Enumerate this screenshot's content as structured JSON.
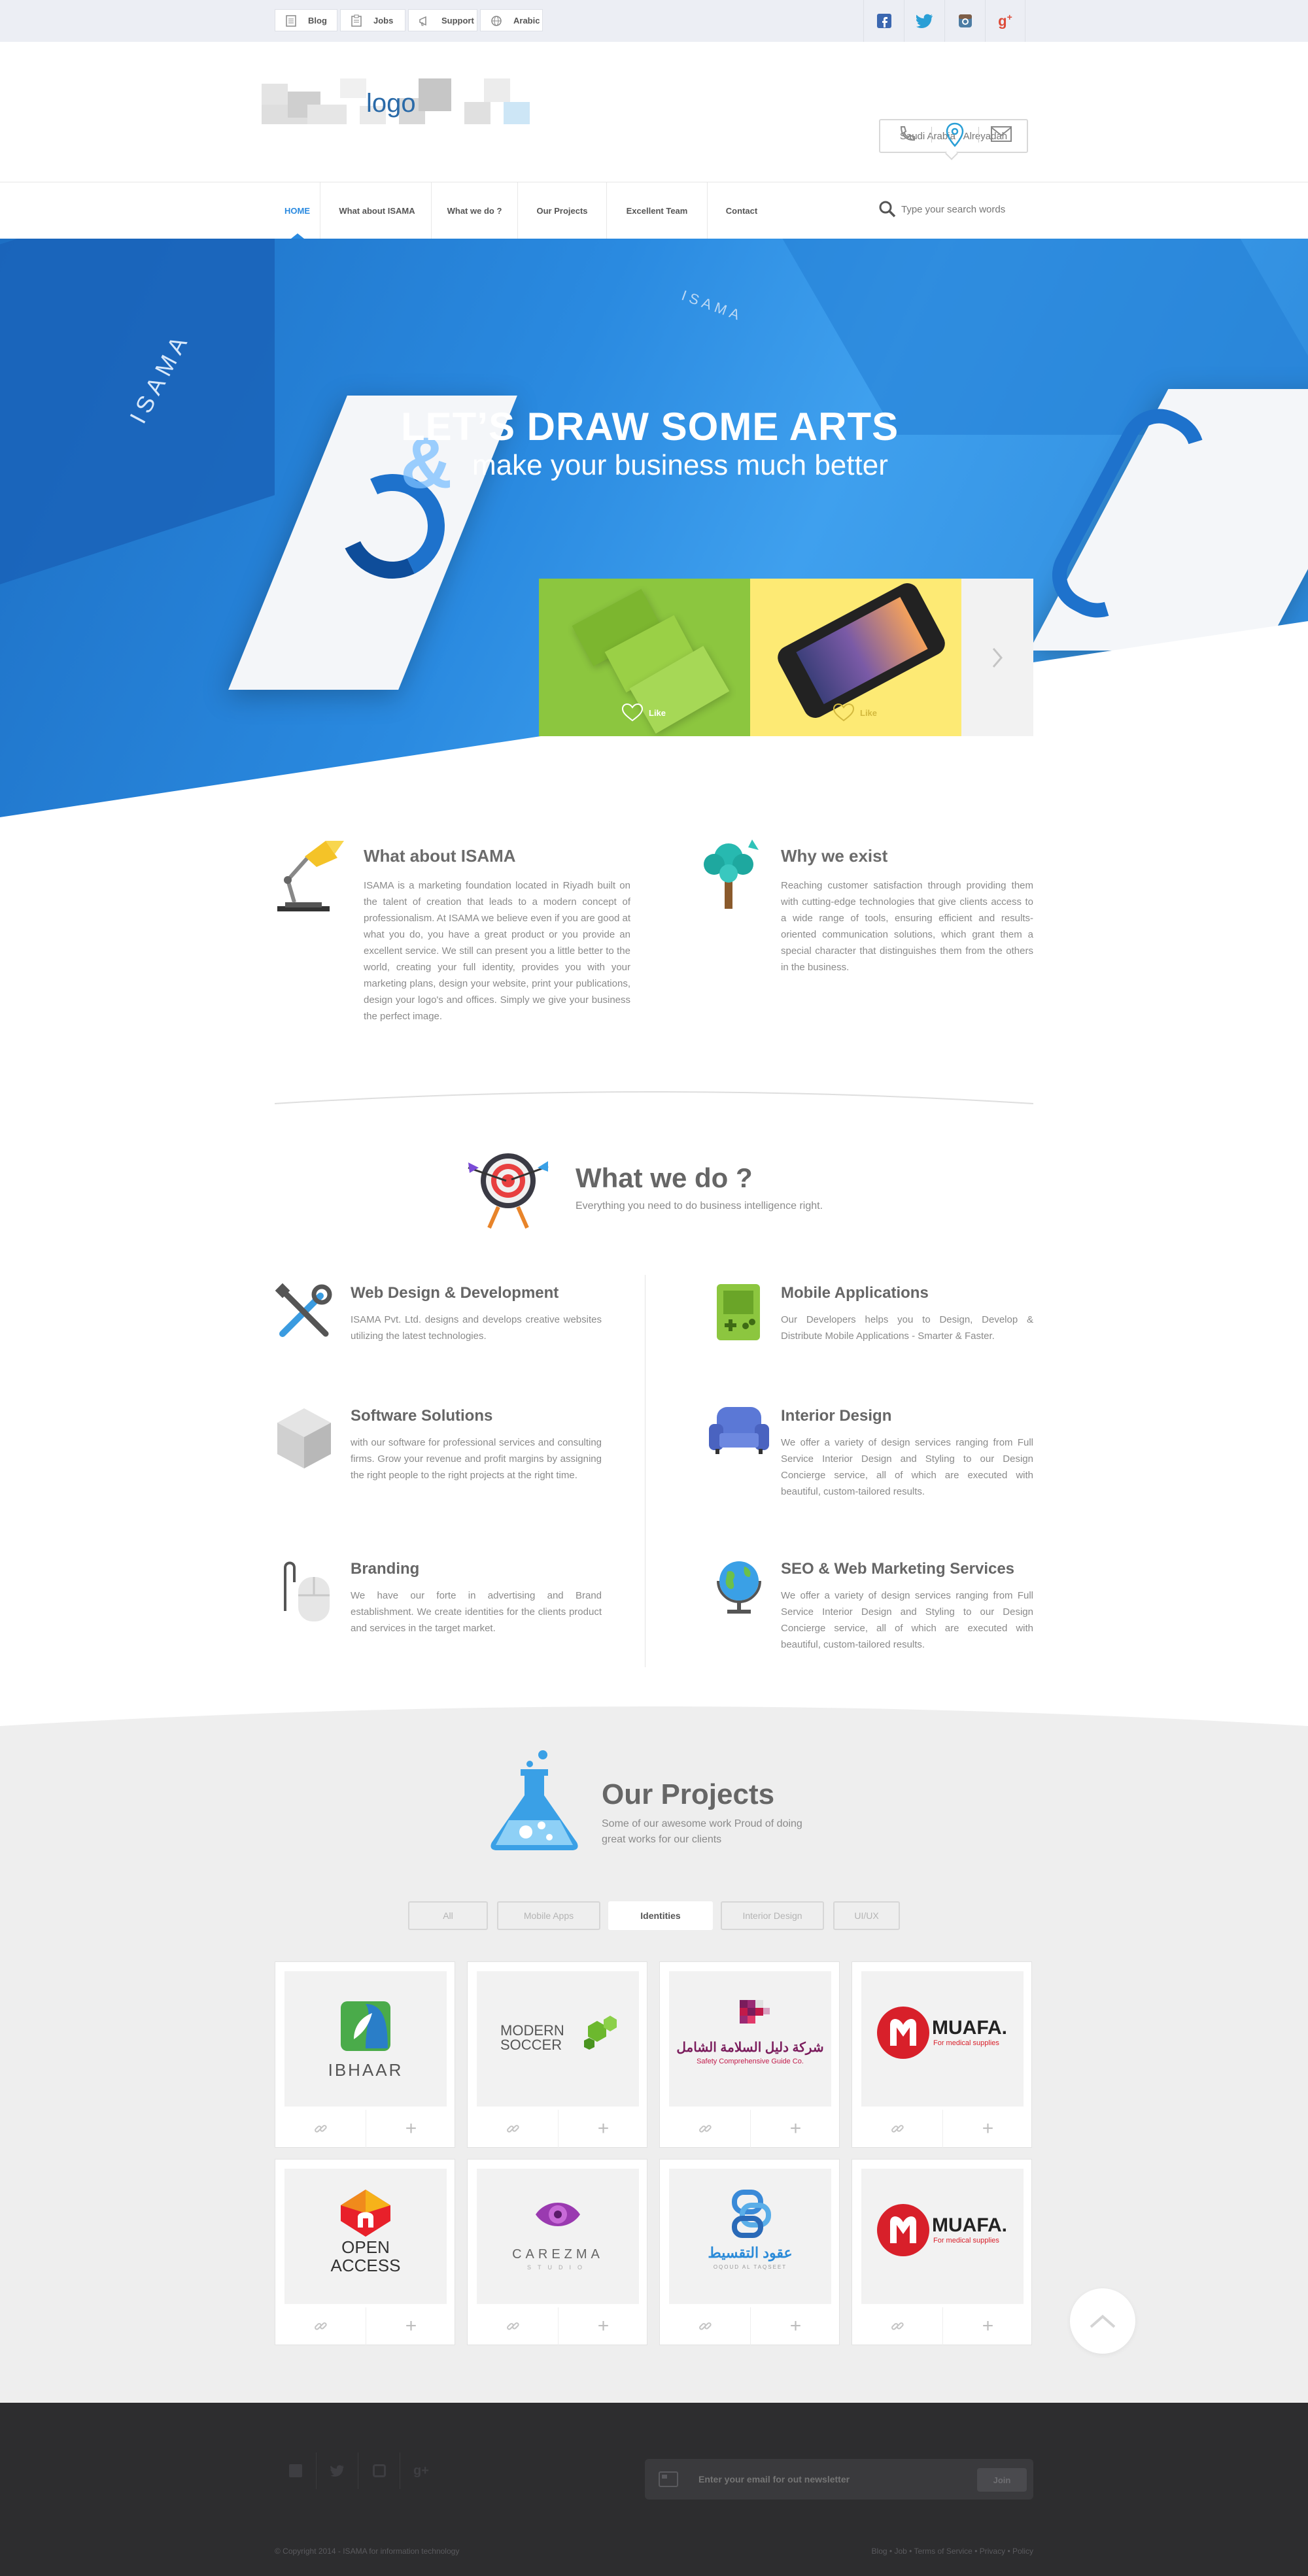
{
  "topbar": {
    "links": [
      {
        "label": "Blog",
        "icon": "document-icon"
      },
      {
        "label": "Jobs",
        "icon": "clipboard-icon"
      },
      {
        "label": "Support",
        "icon": "megaphone-icon"
      },
      {
        "label": "Arabic",
        "icon": "globe-icon"
      }
    ],
    "social": [
      "facebook-icon",
      "twitter-icon",
      "instagram-icon",
      "google-plus-icon"
    ]
  },
  "header": {
    "logo": "logo",
    "location": "Saudi Arabia . Alreyadah"
  },
  "nav": {
    "items": [
      "HOME",
      "What about ISAMA",
      "What we do ?",
      "Our Projects",
      "Excellent Team",
      "Contact"
    ],
    "search_placeholder": "Type your search words"
  },
  "hero": {
    "line1": "LET’S DRAW SOME ARTS",
    "amp": "&",
    "line2": "make your business much better",
    "like": "Like"
  },
  "about": {
    "title": "What about ISAMA",
    "text": "ISAMA is a marketing foundation located in Riyadh built on the talent of creation that leads to a modern concept of professionalism. At ISAMA we believe even if you are good at what you do, you have a great product or you provide an excellent service. We still can present you a little better to the world, creating your full identity, provides you with your marketing plans, design your website, print your publications, design your logo's and offices. Simply we give your business the perfect image."
  },
  "why": {
    "title": "Why we exist",
    "text": "Reaching customer satisfaction through providing them with cutting-edge technologies that give clients access to a wide range of tools, ensuring efficient and results-oriented communication solutions, which grant them a special character that distinguishes them from the others in the business."
  },
  "whatwedo": {
    "title": "What we do ?",
    "subtitle": "Everything you need to do business intelligence right.",
    "services": [
      {
        "title": "Web Design & Development",
        "text": "ISAMA Pvt. Ltd. designs and develops creative websites utilizing the latest technologies."
      },
      {
        "title": "Mobile Applications",
        "text": "Our Developers helps you to Design, Develop & Distribute Mobile Applications - Smarter & Faster."
      },
      {
        "title": "Software Solutions",
        "text": "with our software for professional services and consulting firms. Grow your revenue and profit margins by assigning the right people to the right projects at the right time."
      },
      {
        "title": "Interior Design",
        "text": "We offer a variety of design services ranging from Full Service Interior Design and Styling to our Design Concierge service, all of which are executed with beautiful, custom-tailored results."
      },
      {
        "title": "Branding",
        "text": "We have our forte in advertising and Brand establishment. We create identities for the clients product and services in the target market."
      },
      {
        "title": "SEO & Web Marketing Services",
        "text": "We offer a variety of design services ranging from Full Service Interior Design and Styling to our Design Concierge service, all of which are executed with beautiful, custom-tailored results."
      }
    ]
  },
  "projects": {
    "title": "Our Projects",
    "subtitle1": "Some of our awesome work Proud of doing",
    "subtitle2": "great works for our clients",
    "filters": [
      "All",
      "Mobile Apps",
      "Identities",
      "Interior Design",
      "UI/UX"
    ],
    "active_filter": "Identities",
    "logos": [
      {
        "name": "IBHAAR",
        "sub": ""
      },
      {
        "name": "MODERN",
        "sub": "SOCCER"
      },
      {
        "name": "شركة دليل السلامة الشامل",
        "sub": "Safety Comprehensive Guide Co."
      },
      {
        "name": "MUAFA.",
        "sub": "For medical supplies"
      },
      {
        "name": "OPEN",
        "sub": "ACCESS"
      },
      {
        "name": "CAREZMA",
        "sub": "STUDIO"
      },
      {
        "name": "عقود التقسيط",
        "sub": "OQOUD AL TAQSEET"
      },
      {
        "name": "MUAFA.",
        "sub": "For medical supplies"
      }
    ]
  },
  "footer": {
    "newsletter_placeholder": "Enter your email for out newsletter",
    "join": "Join",
    "copyright": "© Copyright 2014 - ISAMA for information technology",
    "links": [
      "Blog",
      "Job",
      "Terms of Service",
      "Privacy",
      "Policy"
    ]
  },
  "colors": {
    "accent": "#2a8ae0",
    "dark": "#2d2d2f",
    "green": "#8cc63f",
    "yellow": "#fdea74"
  }
}
